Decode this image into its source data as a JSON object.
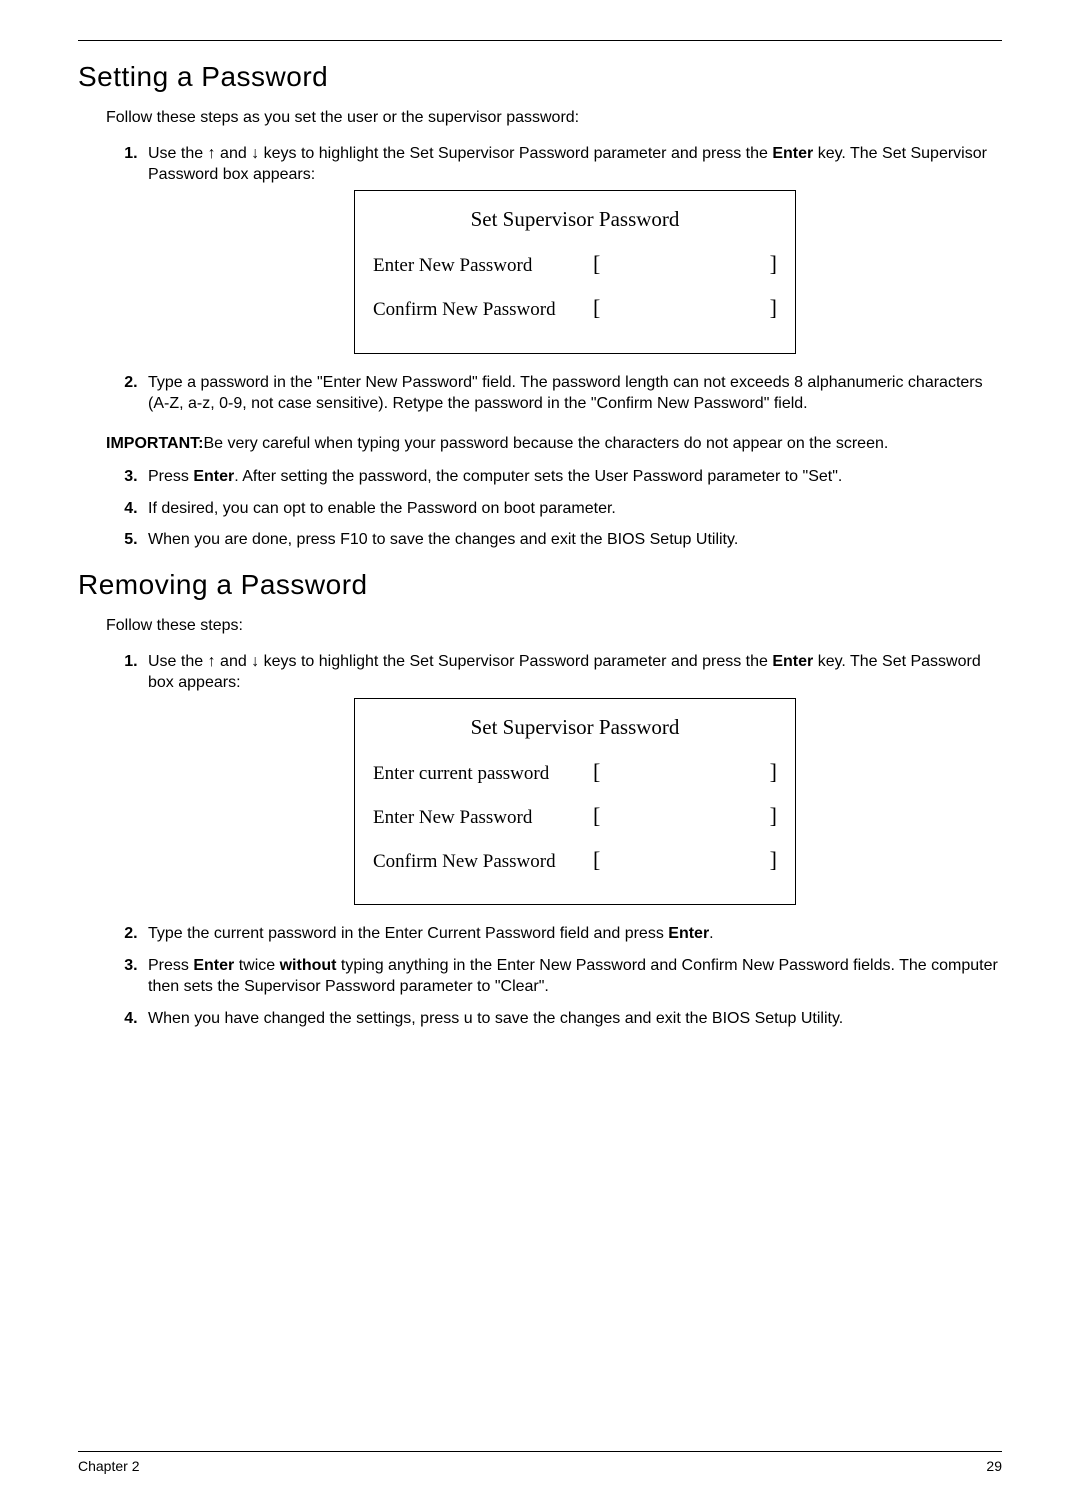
{
  "setting": {
    "heading": "Setting a Password",
    "intro": "Follow these steps as you set the user or the supervisor password:",
    "step1_a": "Use the ",
    "up": "↑",
    "mid": " and ",
    "down": "↓",
    "step1_b": " keys to highlight the Set Supervisor Password parameter and press the ",
    "enter": "Enter",
    "step1_c": " key. The Set Supervisor Password box appears:",
    "dialog": {
      "title": "Set Supervisor Password",
      "row1": "Enter New Password",
      "row2": "Confirm New Password",
      "lb": "[",
      "rb": "]"
    },
    "step2": "Type a password in the \"Enter New Password\" field. The password length can not exceeds 8 alphanumeric characters (A-Z, a-z, 0-9, not case sensitive). Retype the password in the \"Confirm New Password\" field.",
    "important_label": "IMPORTANT:",
    "important_text": "Be very careful when typing your password because the characters do not appear on the screen.",
    "step3_a": "Press ",
    "step3_b": ". After setting the password, the computer sets the User Password parameter to \"Set\".",
    "step4": "If desired, you can opt to enable the Password on boot parameter.",
    "step5": "When you are done, press F10 to save the changes and exit the BIOS Setup Utility."
  },
  "removing": {
    "heading": "Removing a Password",
    "intro": "Follow these steps:",
    "step1_a": "Use the ",
    "step1_b": " keys to highlight the Set Supervisor Password parameter and press the ",
    "step1_c": " key. The Set Password box appears:",
    "dialog": {
      "title": "Set Supervisor Password",
      "row1": "Enter current password",
      "row2": "Enter New Password",
      "row3": "Confirm New Password",
      "lb": "[",
      "rb": "]"
    },
    "step2_a": "Type the current password in the Enter Current Password field and press ",
    "step2_b": ".",
    "step3_a": "Press ",
    "step3_b": " twice ",
    "without": "without",
    "step3_c": " typing anything in the Enter New Password and Confirm New Password fields. The computer then sets the Supervisor Password parameter to \"Clear\".",
    "step4": "When you have changed the settings, press u to save the changes and exit the BIOS Setup Utility."
  },
  "footer": {
    "left": "Chapter 2",
    "right": "29"
  }
}
